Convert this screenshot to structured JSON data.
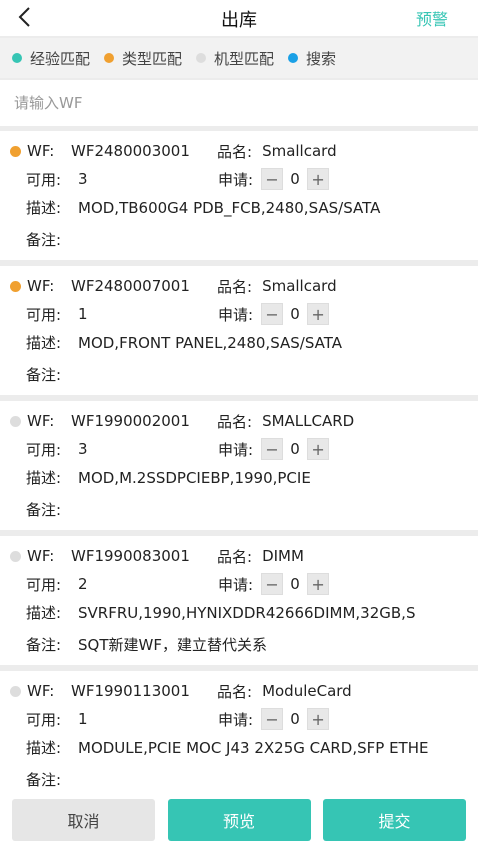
{
  "header": {
    "title": "出库",
    "warn_label": "预警"
  },
  "legend": [
    {
      "label": "经验匹配",
      "color": "#36c5b4"
    },
    {
      "label": "类型匹配",
      "color": "#f0a030"
    },
    {
      "label": "机型匹配",
      "color": "#dddddd"
    },
    {
      "label": "搜索",
      "color": "#1aa0e6"
    }
  ],
  "search": {
    "placeholder": "请输入WF"
  },
  "labels": {
    "wf": "WF:",
    "name": "品名:",
    "available": "可用:",
    "apply": "申请:",
    "desc": "描述:",
    "note": "备注:"
  },
  "items": [
    {
      "wf": "WF2480003001",
      "name": "Smallcard",
      "available": "3",
      "qty": "0",
      "desc": "MOD,TB600G4 PDB_FCB,2480,SAS/SATA",
      "note": "",
      "dot_color": "#f0a030"
    },
    {
      "wf": "WF2480007001",
      "name": "Smallcard",
      "available": "1",
      "qty": "0",
      "desc": "MOD,FRONT PANEL,2480,SAS/SATA",
      "note": "",
      "dot_color": "#f0a030"
    },
    {
      "wf": "WF1990002001",
      "name": "SMALLCARD",
      "available": "3",
      "qty": "0",
      "desc": "MOD,M.2SSDPCIEBP,1990,PCIE",
      "note": "",
      "dot_color": "#dddddd"
    },
    {
      "wf": "WF1990083001",
      "name": "DIMM",
      "available": "2",
      "qty": "0",
      "desc": "SVRFRU,1990,HYNIXDDR42666DIMM,32GB,S",
      "note": "SQT新建WF，建立替代关系",
      "dot_color": "#dddddd"
    },
    {
      "wf": "WF1990113001",
      "name": "ModuleCard",
      "available": "1",
      "qty": "0",
      "desc": "MODULE,PCIE MOC J43 2X25G CARD,SFP ETHE",
      "note": "",
      "dot_color": "#dddddd"
    }
  ],
  "footer": {
    "cancel": "取消",
    "preview": "预览",
    "submit": "提交"
  }
}
